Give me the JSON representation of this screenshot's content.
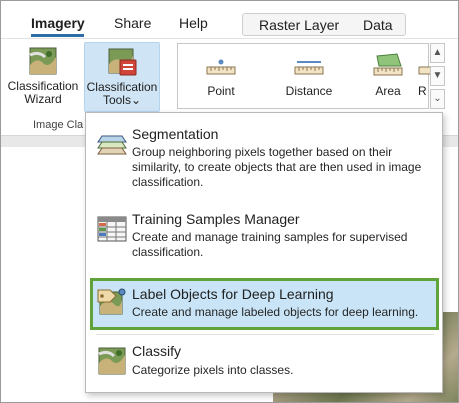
{
  "tabs": [
    {
      "label": "Imagery",
      "active": true
    },
    {
      "label": "Share",
      "active": false
    },
    {
      "label": "Help",
      "active": false
    }
  ],
  "context_tabs": [
    "Raster Layer",
    "Data"
  ],
  "ribbon": {
    "classification_wizard": {
      "line1": "Classification",
      "line2": "Wizard"
    },
    "classification_tools": {
      "line1": "Classification",
      "line2": "Tools",
      "chevron": "⌄"
    },
    "group_label": "Image Cla",
    "measure": {
      "point": "Point",
      "distance": "Distance",
      "area": "Area",
      "partial": "R"
    }
  },
  "menu": {
    "items": [
      {
        "title": "Segmentation",
        "description": "Group neighboring pixels together based on their similarity, to create objects that are then used in image classification.",
        "icon": "segmentation-icon"
      },
      {
        "title": "Training Samples Manager",
        "description": "Create and manage training samples for supervised classification.",
        "icon": "training-samples-icon"
      },
      {
        "title": "Label Objects for Deep Learning",
        "description": "Create and manage labeled objects for deep learning.",
        "icon": "label-objects-icon",
        "highlighted": true
      },
      {
        "title": "Classify",
        "description": "Categorize pixels into classes.",
        "icon": "classify-icon"
      }
    ]
  },
  "colors": {
    "accent": "#2e6ea8",
    "highlight_fill": "#c9e4f6",
    "highlight_border": "#5fa33a",
    "selected_button": "#cfe4f5"
  }
}
